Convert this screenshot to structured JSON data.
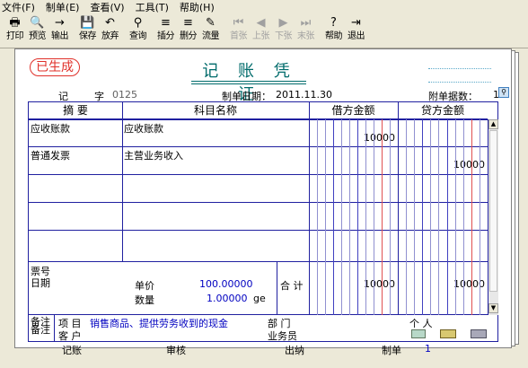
{
  "menu": [
    "文件(F)",
    "制单(E)",
    "查看(V)",
    "工具(T)",
    "帮助(H)"
  ],
  "toolbar": [
    {
      "label": "打印",
      "icon": "print-icon",
      "glyph": "🖶",
      "enabled": true
    },
    {
      "label": "预览",
      "icon": "preview-icon",
      "glyph": "🔍",
      "enabled": true
    },
    {
      "label": "输出",
      "icon": "export-icon",
      "glyph": "→",
      "enabled": true
    },
    {
      "label": "保存",
      "icon": "save-icon",
      "glyph": "💾",
      "enabled": true
    },
    {
      "label": "放弃",
      "icon": "undo-icon",
      "glyph": "↶",
      "enabled": true
    },
    {
      "label": "查询",
      "icon": "binoculars-icon",
      "glyph": "⚲",
      "enabled": true
    },
    {
      "label": "插分",
      "icon": "insert-row-icon",
      "glyph": "≡",
      "enabled": true
    },
    {
      "label": "删分",
      "icon": "delete-row-icon",
      "glyph": "≡",
      "enabled": true
    },
    {
      "label": "流量",
      "icon": "cashflow-icon",
      "glyph": "✎",
      "enabled": true
    },
    {
      "label": "首张",
      "icon": "first-icon",
      "glyph": "⏮",
      "enabled": false
    },
    {
      "label": "上张",
      "icon": "prev-icon",
      "glyph": "◀",
      "enabled": false
    },
    {
      "label": "下张",
      "icon": "next-icon",
      "glyph": "▶",
      "enabled": false
    },
    {
      "label": "末张",
      "icon": "last-icon",
      "glyph": "⏭",
      "enabled": false
    },
    {
      "label": "帮助",
      "icon": "help-icon",
      "glyph": "?",
      "enabled": true
    },
    {
      "label": "退出",
      "icon": "exit-icon",
      "glyph": "⇥",
      "enabled": true
    }
  ],
  "voucher": {
    "stamp": "已生成",
    "title": "记 账 凭 证",
    "type_char": "记",
    "zi": "字",
    "number": "0125",
    "date_label": "制单日期：",
    "date": "2011.11.30",
    "attachments_label": "附单据数：",
    "attachments": "1",
    "columns": {
      "summary": "摘 要",
      "account": "科目名称",
      "debit": "借方金额",
      "credit": "贷方金额"
    },
    "rows": [
      {
        "summary": "应收账款",
        "account": "应收账款",
        "debit": "10000",
        "credit": ""
      },
      {
        "summary": "普通发票",
        "account": "主营业务收入",
        "debit": "",
        "credit": "10000"
      },
      {
        "summary": "",
        "account": "",
        "debit": "",
        "credit": ""
      },
      {
        "summary": "",
        "account": "",
        "debit": "",
        "credit": ""
      },
      {
        "summary": "",
        "account": "",
        "debit": "",
        "credit": ""
      }
    ],
    "footer": {
      "ticket_no_label": "票号",
      "date_label": "日期",
      "unit_price_label": "单价",
      "unit_price": "100.00000",
      "quantity_label": "数量",
      "quantity": "1.00000",
      "unit": "ge",
      "total_label": "合 计",
      "total_debit": "10000",
      "total_credit": "10000"
    },
    "remarks": {
      "label": "备注",
      "project_label": "项  目",
      "project_value": "销售商品、提供劳务收到的现金",
      "dept_label": "部  门",
      "person_label": "个  人",
      "customer_label": "客  户",
      "salesperson_label": "业务员"
    },
    "signoff": {
      "bookkeeping": "记账",
      "audit": "审核",
      "cashier": "出纳",
      "maker": "制单",
      "maker_value": "1"
    }
  }
}
